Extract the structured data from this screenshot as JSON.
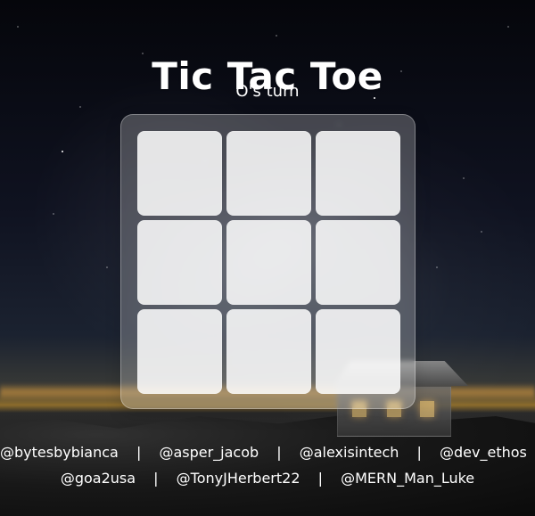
{
  "game": {
    "title": "Tic Tac Toe",
    "status": "O's turn",
    "board": [
      [
        "",
        "",
        ""
      ],
      [
        "",
        "",
        ""
      ],
      [
        "",
        "",
        ""
      ]
    ]
  },
  "credits": {
    "row1": [
      "@bytesbybianca",
      "@asper_jacob",
      "@alexisintech",
      "@dev_ethos"
    ],
    "row2": [
      "@goa2usa",
      "@TonyJHerbert22",
      "@MERN_Man_Luke"
    ],
    "separator": "|"
  }
}
